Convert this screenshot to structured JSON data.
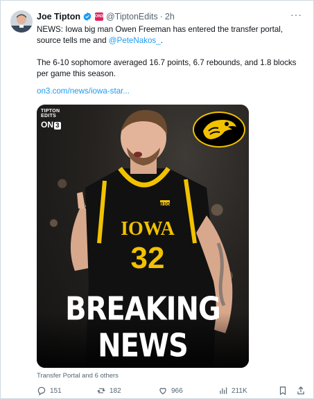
{
  "tweet": {
    "author_name": "Joe Tipton",
    "handle": "@TiptonEdits",
    "separator": "·",
    "time": "2h",
    "more": "···",
    "brand_badge_text": "ON3",
    "text_line1_prefix": "NEWS: Iowa big man Owen Freeman has entered the transfer portal, source tells me and ",
    "mention": "@PeteNakos_",
    "text_line1_suffix": ".",
    "text_p2": "The 6-10 sophomore averaged 16.7 points, 6.7 rebounds, and 1.8 blocks per game this season.",
    "link": "on3.com/news/iowa-star..."
  },
  "media": {
    "watermark_top": "TIPTON",
    "watermark_bottom": "EDITS",
    "on3_prefix": "ON",
    "on3_num": "3",
    "jersey_team": "IOWA",
    "jersey_number": "32",
    "jersey_conf": "B1G",
    "headline": "BREAKING NEWS"
  },
  "topics": "Transfer Portal and 6 others",
  "actions": {
    "replies": "151",
    "reposts": "182",
    "likes": "966",
    "views": "211K"
  },
  "colors": {
    "link": "#1d9bf0",
    "muted": "#536471",
    "iowa_gold": "#f2c200",
    "jersey_black": "#111111"
  }
}
